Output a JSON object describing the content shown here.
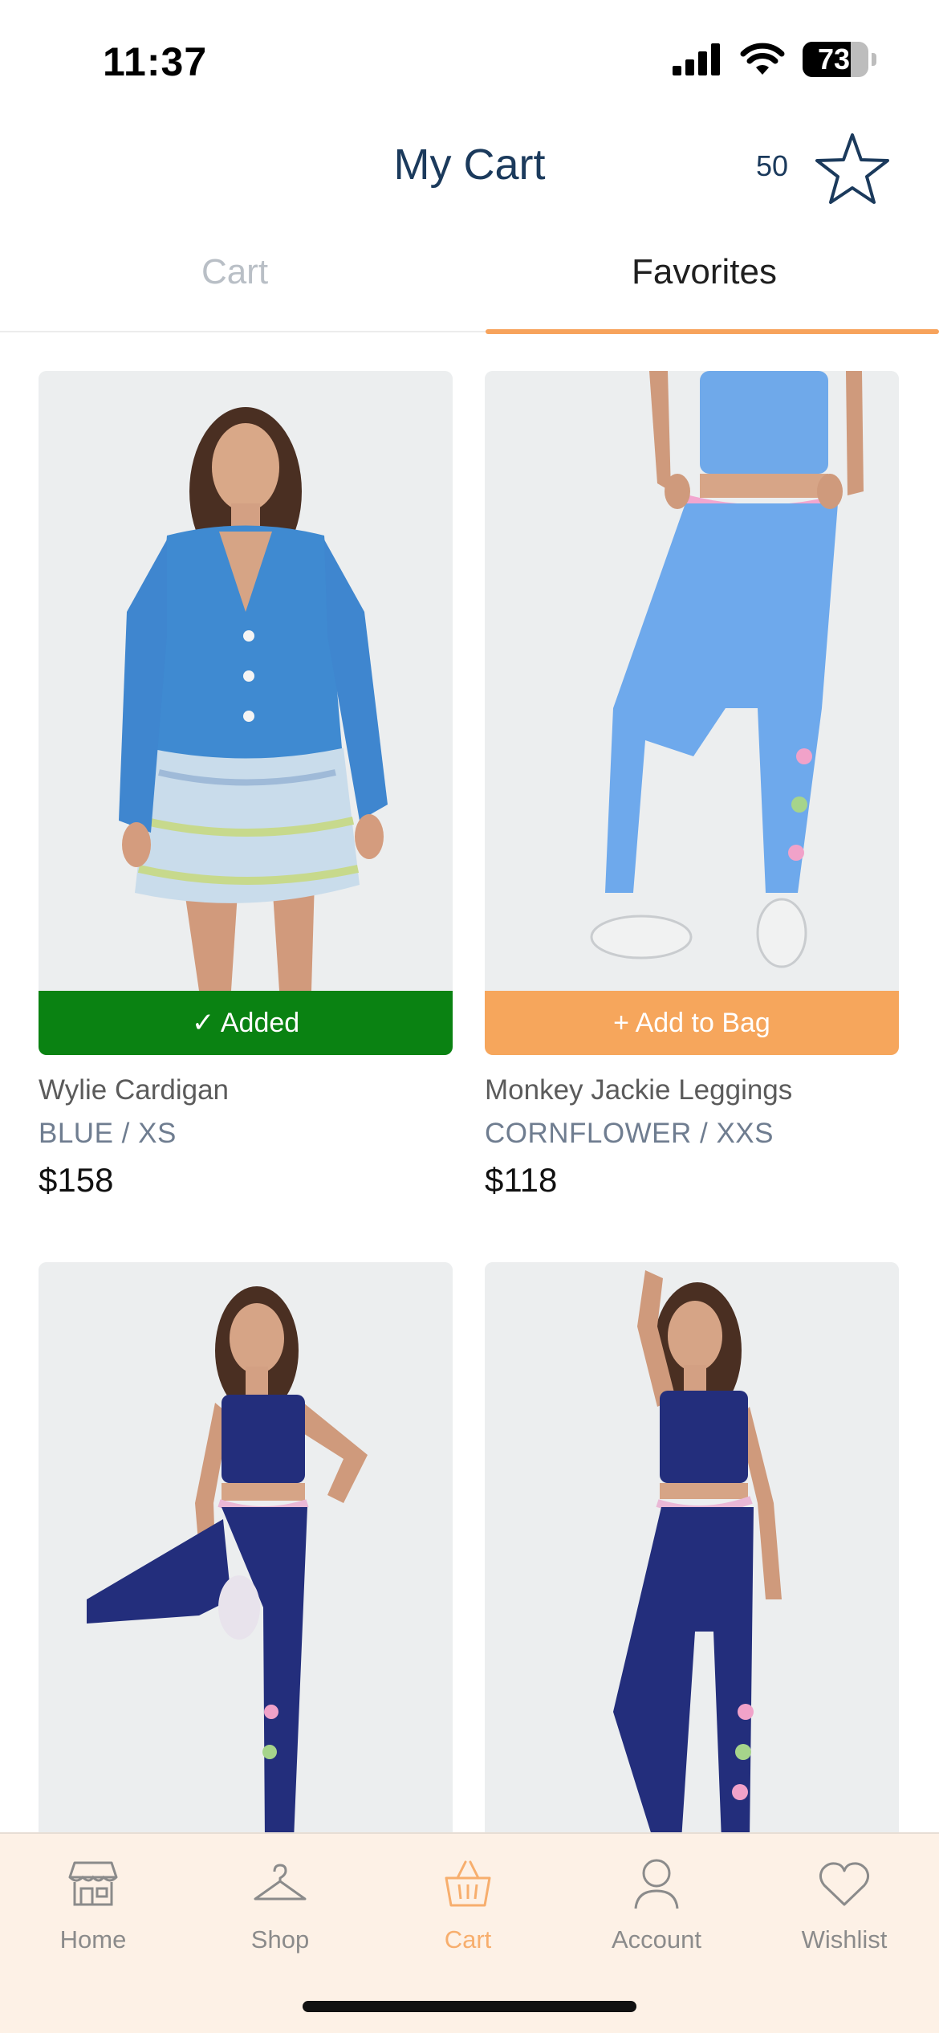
{
  "status_bar": {
    "time": "11:37",
    "battery": "73",
    "battery_level": 0.73
  },
  "header": {
    "title": "My Cart",
    "favorites_count": "50",
    "icon": "star-icon"
  },
  "tabs": [
    {
      "label": "Cart",
      "active": false
    },
    {
      "label": "Favorites",
      "active": true
    }
  ],
  "products": [
    {
      "name": "Wylie Cardigan",
      "variant": "BLUE / XS",
      "price": "$158",
      "button": "✓ Added",
      "button_state": "added"
    },
    {
      "name": "Monkey Jackie Leggings",
      "variant": "CORNFLOWER / XXS",
      "price": "$118",
      "button": "+ Add to Bag",
      "button_state": "add"
    },
    {
      "name": "",
      "variant": "",
      "price": "",
      "button": "",
      "button_state": ""
    },
    {
      "name": "",
      "variant": "",
      "price": "",
      "button": "",
      "button_state": ""
    }
  ],
  "bottom_nav": [
    {
      "label": "Home",
      "icon": "store-icon",
      "current": false
    },
    {
      "label": "Shop",
      "icon": "hanger-icon",
      "current": false
    },
    {
      "label": "Cart",
      "icon": "basket-icon",
      "current": true
    },
    {
      "label": "Account",
      "icon": "person-icon",
      "current": false
    },
    {
      "label": "Wishlist",
      "icon": "heart-icon",
      "current": false
    }
  ],
  "colors": {
    "accent": "#f7a35c",
    "title": "#1b3a5c",
    "added_green": "#0a8212",
    "add_orange": "#f6a65c",
    "nav_bg": "#fdf1e6"
  }
}
